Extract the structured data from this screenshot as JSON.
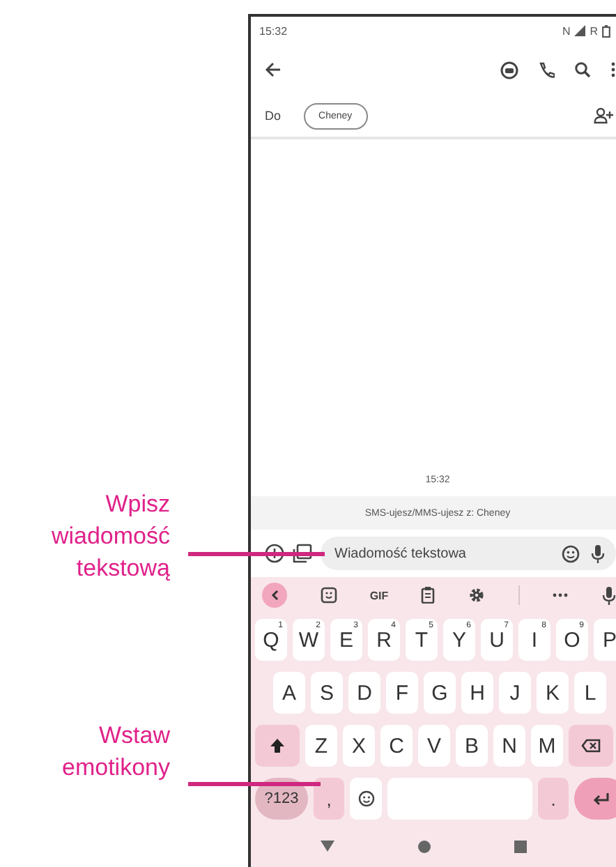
{
  "annotations": [
    {
      "text": "Wpisz\nwiadomość\ntekstową"
    },
    {
      "text": "Wstaw\nemotikony"
    }
  ],
  "status_bar": {
    "time": "15:32",
    "indicators": [
      "N",
      "R"
    ]
  },
  "recipient": {
    "label": "Do",
    "chip": "Cheney"
  },
  "conversation": {
    "timestamp": "15:32",
    "info": "SMS-ujesz/MMS-ujesz z: Cheney"
  },
  "compose": {
    "placeholder": "Wiadomość tekstowa"
  },
  "keyboard": {
    "toolbar_text": "GIF",
    "rows": [
      [
        {
          "label": "Q",
          "hint": "1"
        },
        {
          "label": "W",
          "hint": "2"
        },
        {
          "label": "E",
          "hint": "3"
        },
        {
          "label": "R",
          "hint": "4"
        },
        {
          "label": "T",
          "hint": "5"
        },
        {
          "label": "Y",
          "hint": "6"
        },
        {
          "label": "U",
          "hint": "7"
        },
        {
          "label": "I",
          "hint": "8"
        },
        {
          "label": "O",
          "hint": "9"
        },
        {
          "label": "P"
        }
      ],
      [
        {
          "label": "A"
        },
        {
          "label": "S"
        },
        {
          "label": "D"
        },
        {
          "label": "F"
        },
        {
          "label": "G"
        },
        {
          "label": "H"
        },
        {
          "label": "J"
        },
        {
          "label": "K"
        },
        {
          "label": "L"
        }
      ],
      [
        {
          "label": "Z"
        },
        {
          "label": "X"
        },
        {
          "label": "C"
        },
        {
          "label": "V"
        },
        {
          "label": "B"
        },
        {
          "label": "N"
        },
        {
          "label": "M"
        }
      ]
    ],
    "bottom_row": [
      {
        "kind": "symbols",
        "label": "?123"
      },
      {
        "kind": "punct",
        "label": ","
      },
      {
        "kind": "emoji"
      },
      {
        "kind": "space"
      },
      {
        "kind": "punct",
        "label": "."
      },
      {
        "kind": "enter"
      }
    ]
  }
}
